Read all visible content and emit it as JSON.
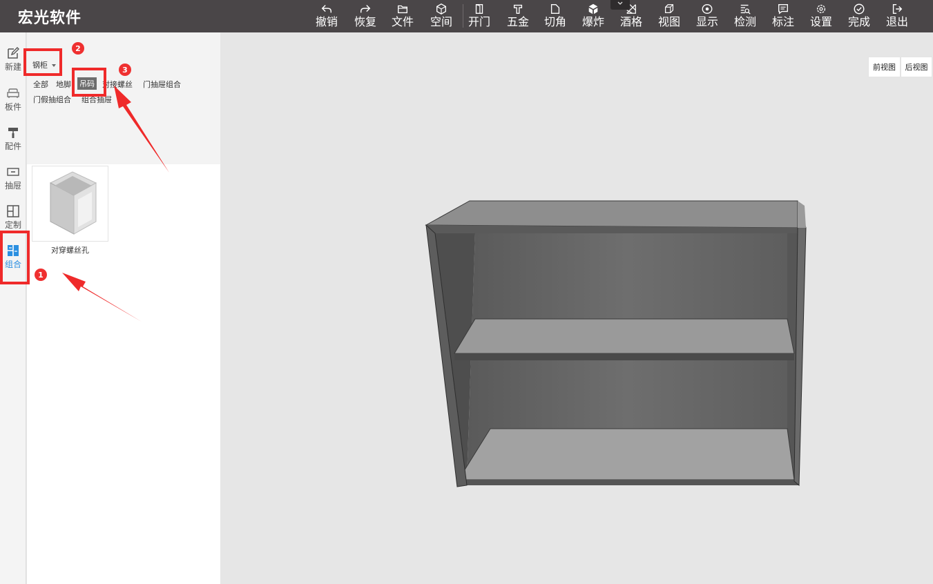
{
  "app": {
    "title": "宏光软件"
  },
  "toolbar": {
    "items": [
      {
        "label": "撤销",
        "icon": "undo-icon"
      },
      {
        "label": "恢复",
        "icon": "redo-icon"
      },
      {
        "label": "文件",
        "icon": "folder-icon"
      },
      {
        "label": "空间",
        "icon": "cube-icon"
      },
      {
        "label": "开门",
        "icon": "door-icon"
      },
      {
        "label": "五金",
        "icon": "hardware-icon"
      },
      {
        "label": "切角",
        "icon": "cut-corner-icon"
      },
      {
        "label": "爆炸",
        "icon": "explode-icon"
      },
      {
        "label": "酒格",
        "icon": "wine-rack-icon"
      },
      {
        "label": "视图",
        "icon": "view-icon"
      },
      {
        "label": "显示",
        "icon": "eye-icon"
      },
      {
        "label": "检测",
        "icon": "inspect-icon"
      },
      {
        "label": "标注",
        "icon": "annotate-icon"
      },
      {
        "label": "设置",
        "icon": "gear-icon"
      },
      {
        "label": "完成",
        "icon": "check-circle-icon"
      },
      {
        "label": "退出",
        "icon": "exit-icon"
      }
    ]
  },
  "sidebar": {
    "items": [
      {
        "label": "新建",
        "icon": "edit-icon"
      },
      {
        "label": "板件",
        "icon": "sofa-icon"
      },
      {
        "label": "配件",
        "icon": "paint-roller-icon"
      },
      {
        "label": "抽屉",
        "icon": "drawer-icon"
      },
      {
        "label": "定制",
        "icon": "layout-icon"
      },
      {
        "label": "组合",
        "icon": "combine-icon",
        "active": true
      }
    ]
  },
  "catalog": {
    "category_select": "钢柜",
    "tags": [
      "全部",
      "地脚",
      "吊码",
      "对接螺丝",
      "门抽屉组合",
      "门假抽组合",
      "组合抽屉"
    ],
    "selected_tag": "吊码",
    "items": [
      {
        "label": "对穿螺丝孔"
      }
    ]
  },
  "view_buttons": {
    "front": "前视图",
    "back": "后视图"
  },
  "annotations": {
    "badges": [
      "1",
      "2",
      "3"
    ],
    "color": "#ef2a2a"
  },
  "colors": {
    "toolbar_bg": "#4a4648",
    "accent": "#2b8fe0",
    "highlight": "#ef2a2a"
  }
}
